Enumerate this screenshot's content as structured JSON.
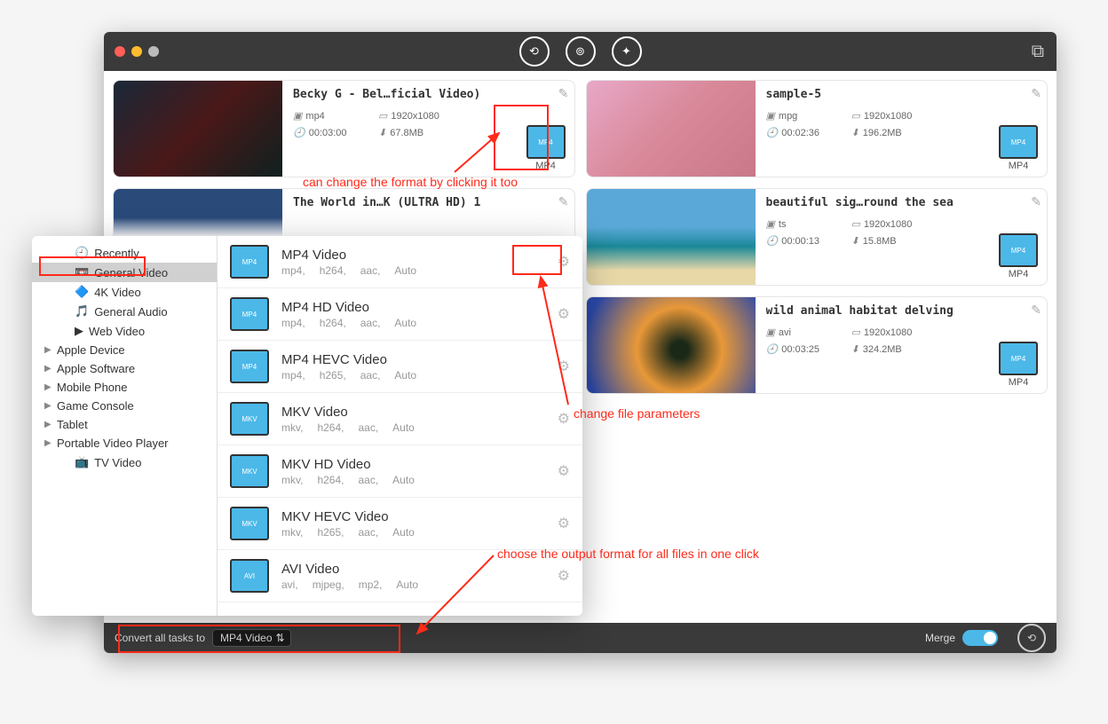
{
  "videos": [
    {
      "title": "Becky G - Bel…ficial Video)",
      "container": "mp4",
      "res": "1920x1080",
      "dur": "00:03:00",
      "size": "67.8MB",
      "fmt": "MP4",
      "thumbClass": "t1"
    },
    {
      "title": "The World in…K (ULTRA HD) 1",
      "container": "",
      "res": "",
      "dur": "",
      "size": "",
      "fmt": "",
      "thumbClass": "t2"
    },
    {
      "title": "sample-5",
      "container": "mpg",
      "res": "1920x1080",
      "dur": "00:02:36",
      "size": "196.2MB",
      "fmt": "MP4",
      "thumbClass": "t3"
    },
    {
      "title": "beautiful sig…round the sea",
      "container": "ts",
      "res": "1920x1080",
      "dur": "00:00:13",
      "size": "15.8MB",
      "fmt": "MP4",
      "thumbClass": "t4"
    },
    {
      "title": "wild animal habitat delving",
      "container": "avi",
      "res": "1920x1080",
      "dur": "00:03:25",
      "size": "324.2MB",
      "fmt": "MP4",
      "thumbClass": "t5"
    }
  ],
  "sidebar": {
    "recently": "Recently",
    "selected": "General Video",
    "items": [
      "4K Video",
      "General Audio",
      "Web Video"
    ],
    "groups": [
      "Apple Device",
      "Apple Software",
      "Mobile Phone",
      "Game Console",
      "Tablet",
      "Portable Video Player"
    ],
    "tv": "TV Video"
  },
  "formats": [
    {
      "name": "MP4 Video",
      "p": [
        "mp4,",
        "h264,",
        "aac,",
        "Auto"
      ]
    },
    {
      "name": "MP4 HD Video",
      "p": [
        "mp4,",
        "h264,",
        "aac,",
        "Auto"
      ]
    },
    {
      "name": "MP4 HEVC Video",
      "p": [
        "mp4,",
        "h265,",
        "aac,",
        "Auto"
      ]
    },
    {
      "name": "MKV Video",
      "p": [
        "mkv,",
        "h264,",
        "aac,",
        "Auto"
      ]
    },
    {
      "name": "MKV HD Video",
      "p": [
        "mkv,",
        "h264,",
        "aac,",
        "Auto"
      ]
    },
    {
      "name": "MKV HEVC Video",
      "p": [
        "mkv,",
        "h265,",
        "aac,",
        "Auto"
      ]
    },
    {
      "name": "AVI Video",
      "p": [
        "avi,",
        "mjpeg,",
        "mp2,",
        "Auto"
      ]
    }
  ],
  "bottom": {
    "label": "Convert all tasks to",
    "value": "MP4 Video",
    "merge": "Merge"
  },
  "annotations": {
    "a1": "can change the format by clicking it too",
    "a2": "change file parameters",
    "a3": "choose the output format for all files in one click"
  }
}
